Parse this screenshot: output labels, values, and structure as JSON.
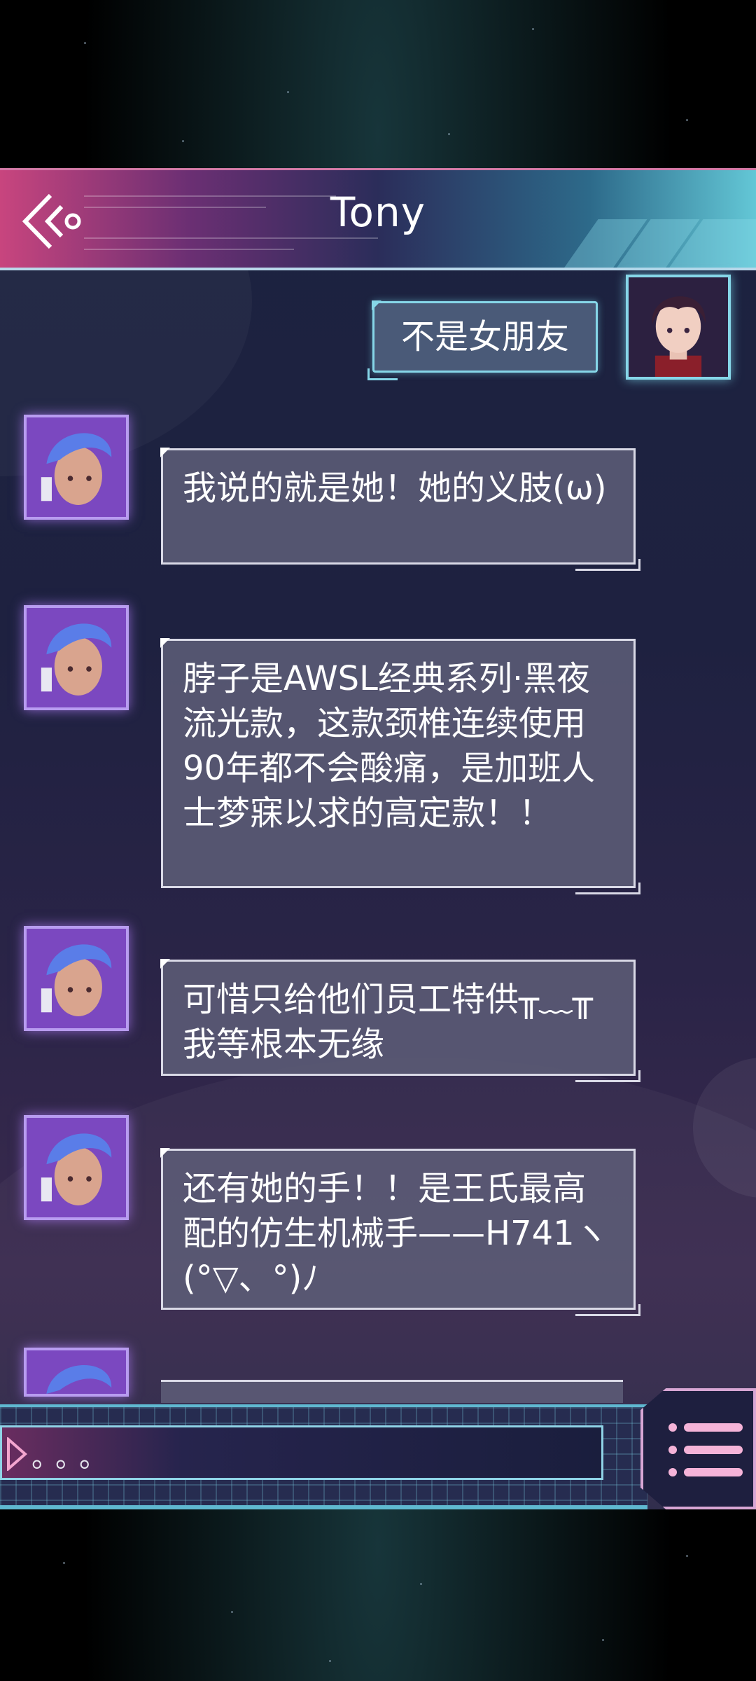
{
  "header": {
    "title": "Tony",
    "back_icon": "back-chevron-icon"
  },
  "messages": [
    {
      "sender": "player",
      "avatar_icon": "player-avatar",
      "text": "不是女朋友"
    },
    {
      "sender": "npc",
      "avatar_icon": "npc-avatar",
      "text": "我说的就是她！她的义肢(ω)"
    },
    {
      "sender": "npc",
      "avatar_icon": "npc-avatar",
      "text": "脖子是AWSL经典系列·黑夜流光款，这款颈椎连续使用90年都不会酸痛，是加班人士梦寐以求的高定款！！"
    },
    {
      "sender": "npc",
      "avatar_icon": "npc-avatar",
      "text": "可惜只给他们员工特供╥﹏╥我等根本无缘"
    },
    {
      "sender": "npc",
      "avatar_icon": "npc-avatar",
      "text": "还有她的手！！是王氏最高配的仿生机械手——H741ヽ(°▽、°)ﾉ"
    }
  ],
  "input": {
    "placeholder": "。。。",
    "play_icon": "play-triangle-icon"
  },
  "menu": {
    "icon": "menu-list-icon"
  },
  "colors": {
    "accent_pink": "#c8457e",
    "accent_cyan": "#63c7d6",
    "bubble_bg": "#5c5c76",
    "panel_bg": "#1e2140"
  }
}
